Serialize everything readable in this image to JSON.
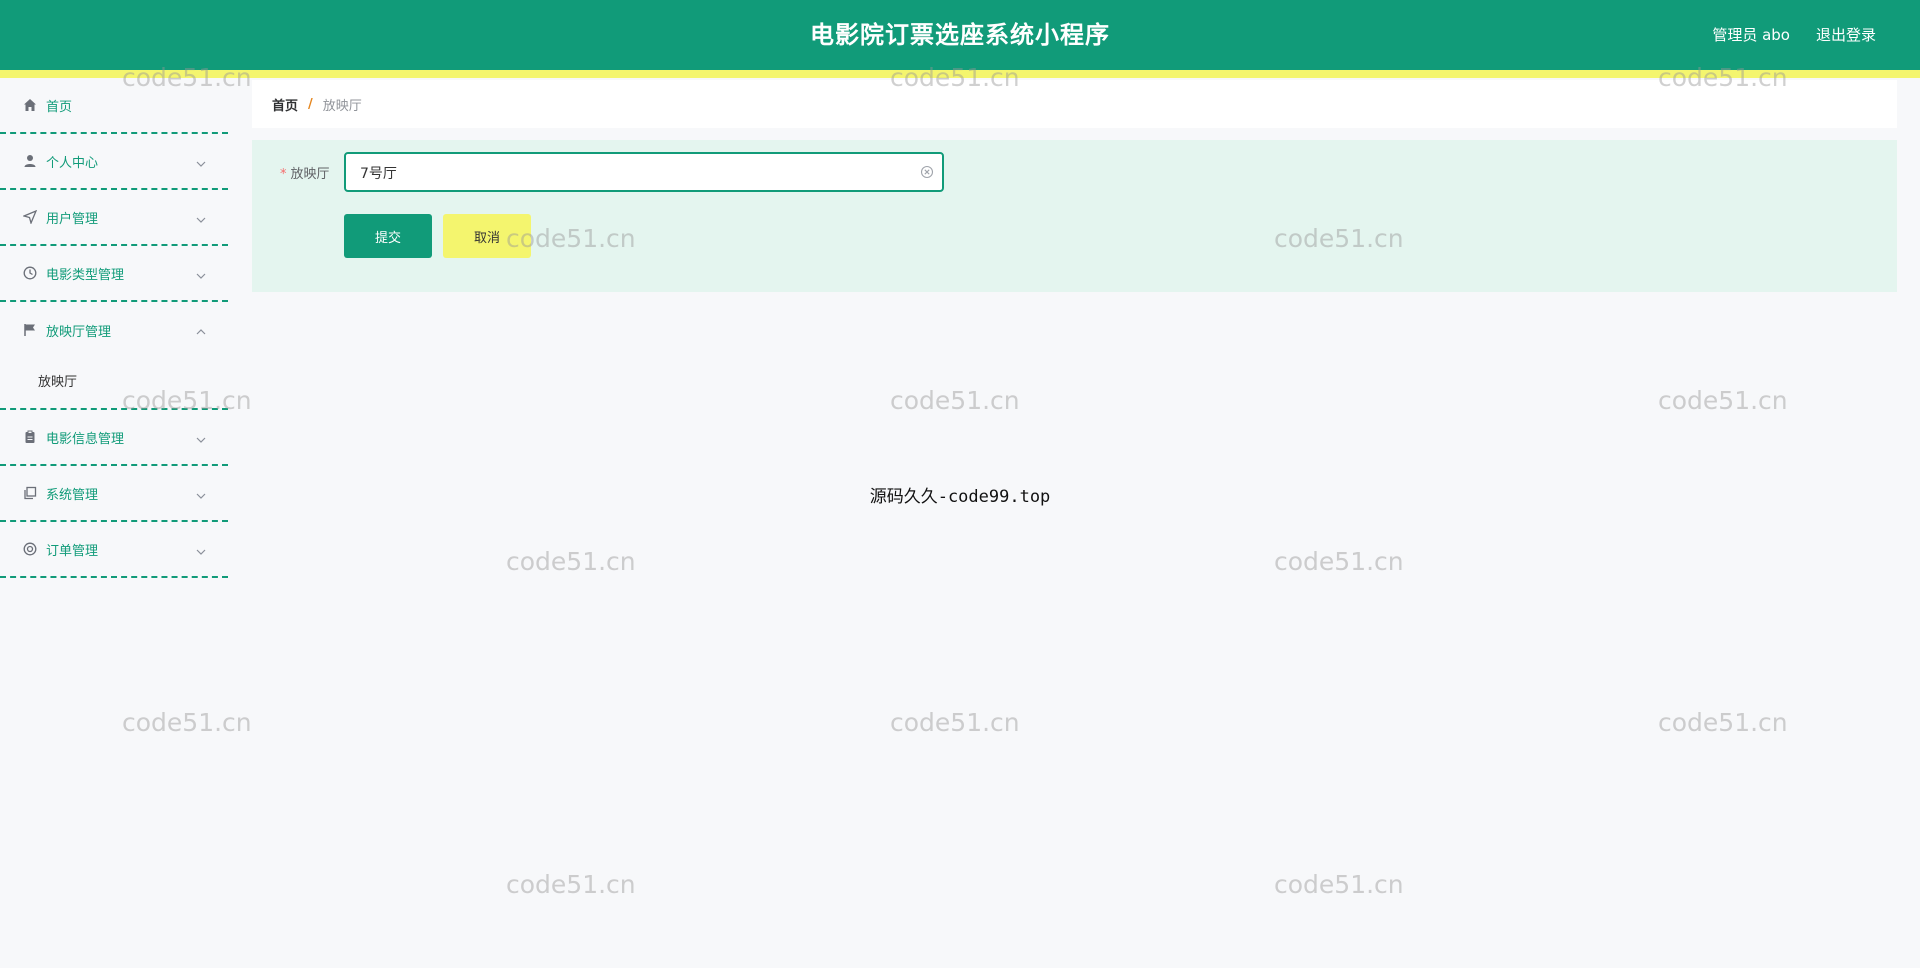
{
  "header": {
    "title": "电影院订票选座系统小程序",
    "user_info": "管理员 abo",
    "logout": "退出登录"
  },
  "sidebar": {
    "items": [
      {
        "label": "首页",
        "icon": "home-icon",
        "expandable": false
      },
      {
        "label": "个人中心",
        "icon": "user-icon",
        "expandable": true
      },
      {
        "label": "用户管理",
        "icon": "send-icon",
        "expandable": true
      },
      {
        "label": "电影类型管理",
        "icon": "clock-icon",
        "expandable": true
      },
      {
        "label": "放映厅管理",
        "icon": "flag-icon",
        "expandable": true,
        "expanded": true,
        "children": [
          "放映厅"
        ]
      },
      {
        "label": "电影信息管理",
        "icon": "clipboard-icon",
        "expandable": true
      },
      {
        "label": "系统管理",
        "icon": "copy-icon",
        "expandable": true
      },
      {
        "label": "订单管理",
        "icon": "life-ring-icon",
        "expandable": true
      }
    ]
  },
  "breadcrumb": {
    "home": "首页",
    "separator": "/",
    "current": "放映厅"
  },
  "form": {
    "field_label": "放映厅",
    "required_mark": "*",
    "field_value": "7号厅",
    "submit": "提交",
    "cancel": "取消"
  },
  "center_text": "源码久久-code99.top",
  "watermark": "code51.cn",
  "colors": {
    "primary": "#119b79",
    "accent_yellow": "#f4f56e",
    "form_bg": "#e4f5ef"
  }
}
